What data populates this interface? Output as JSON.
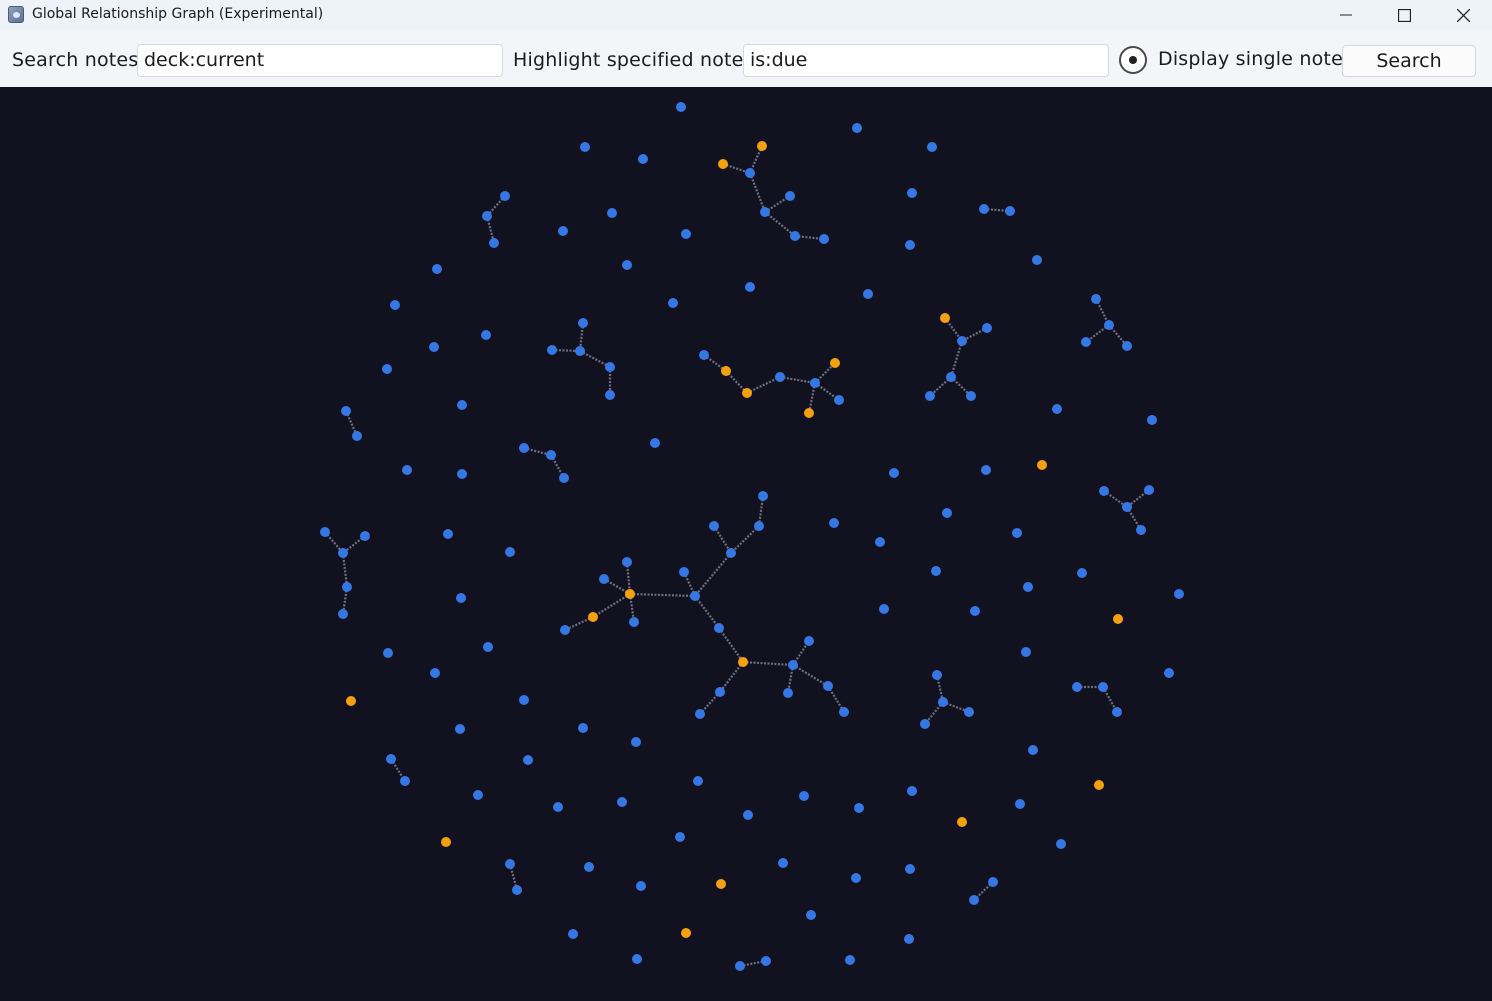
{
  "window": {
    "title": "Global Relationship Graph (Experimental)"
  },
  "toolbar": {
    "search_label": "Search notes:",
    "search_value": "deck:current",
    "highlight_label": "Highlight specified notes:",
    "highlight_value": "is:due",
    "single_notes_label": "Display single notes",
    "single_notes_checked": true,
    "search_button": "Search"
  },
  "icons": {
    "app": "app-icon",
    "minimize": "minimize-icon",
    "maximize": "maximize-icon",
    "close": "close-icon"
  },
  "colors": {
    "graph_background": "#111120",
    "note": "#3578e5",
    "highlighted_note": "#f5a00f",
    "edge": "#6f6f83"
  }
}
